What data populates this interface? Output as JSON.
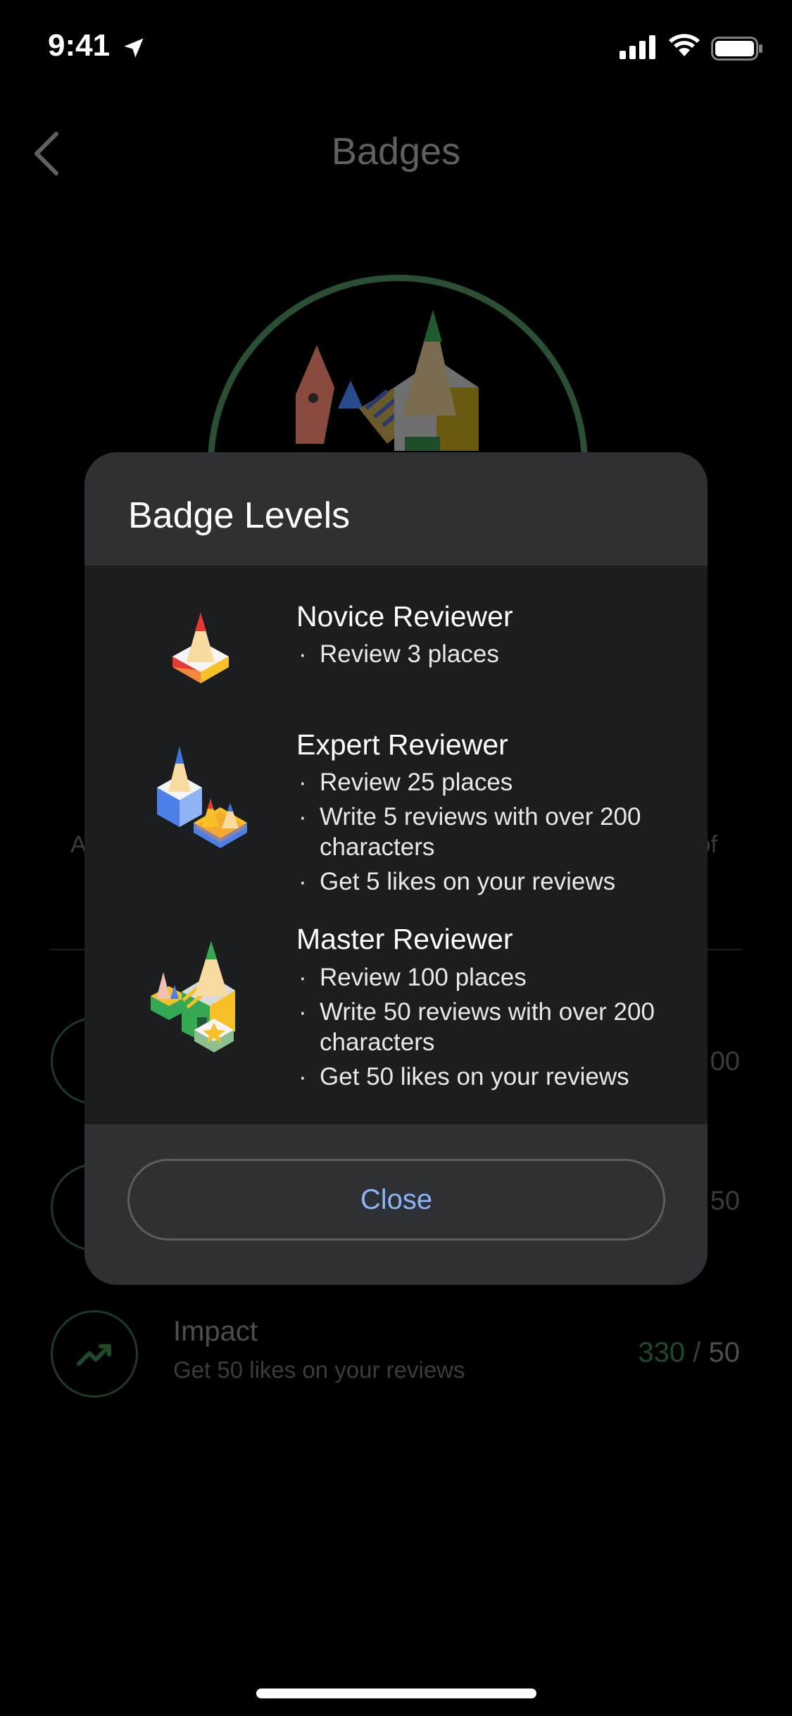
{
  "status_bar": {
    "time": "9:41"
  },
  "background": {
    "title": "Badges",
    "side_left": "A",
    "side_right": "of",
    "rows": [
      {
        "right": "00"
      },
      {
        "right": "50"
      }
    ],
    "impact": {
      "title": "Impact",
      "subtitle": "Get 50 likes on your reviews",
      "current": "330",
      "separator": " / ",
      "target": "50"
    }
  },
  "modal": {
    "title": "Badge Levels",
    "levels": [
      {
        "name": "Novice Reviewer",
        "requirements": [
          "Review 3 places"
        ]
      },
      {
        "name": "Expert Reviewer",
        "requirements": [
          "Review 25 places",
          "Write 5 reviews with over 200 characters",
          "Get 5 likes on your reviews"
        ]
      },
      {
        "name": "Master Reviewer",
        "requirements": [
          "Review 100 places",
          "Write 50 reviews with over 200 characters",
          "Get 50 likes on your reviews"
        ]
      }
    ],
    "close_label": "Close",
    "bullet": "·"
  },
  "icons": [
    "back-chevron-icon",
    "location-arrow-icon",
    "cellular-signal-icon",
    "wifi-icon",
    "battery-icon",
    "trending-up-icon"
  ],
  "colors": {
    "accent": "#8ab4f8",
    "ring": "#2b4f33",
    "modal_bg": "#1c1d1f",
    "modal_header": "#2f3034"
  }
}
